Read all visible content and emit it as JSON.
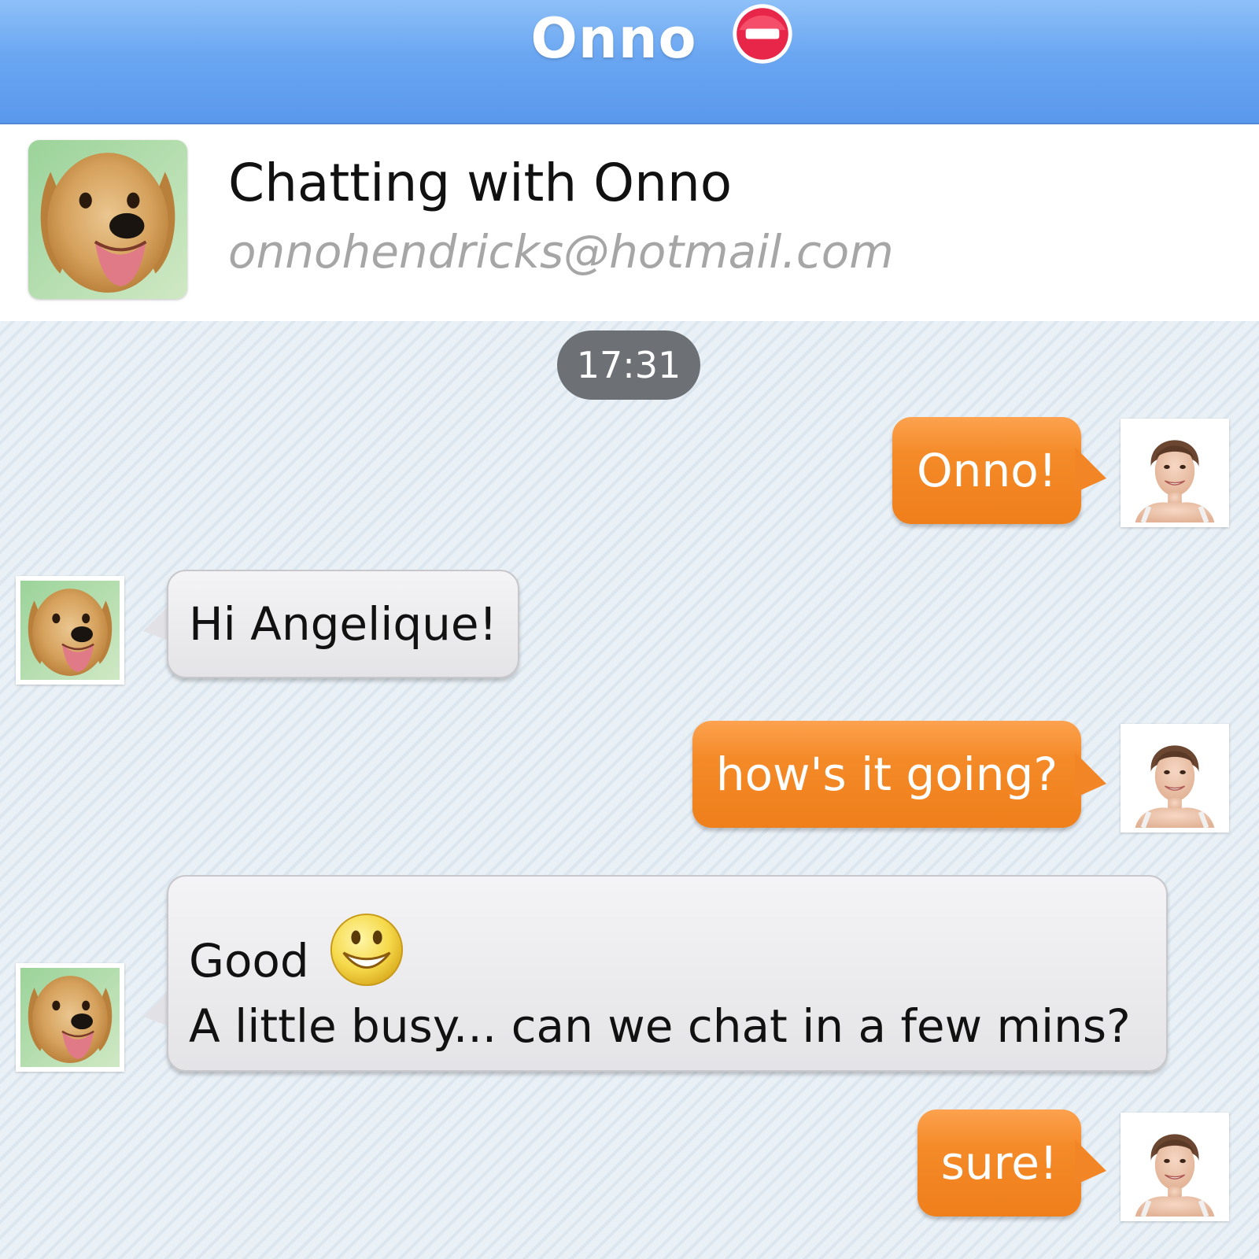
{
  "window": {
    "title": "Onno",
    "status_icon": "busy-icon",
    "accent_color": "#6aa6f1"
  },
  "contact": {
    "chatting_with": "Chatting with Onno",
    "email": "onnohendricks@hotmail.com",
    "avatar_icon": "dog-avatar"
  },
  "chat": {
    "timestamp": "17:31",
    "outgoing_color": "#f48a28",
    "incoming_color": "#e4e4e7",
    "messages": [
      {
        "sender": "me",
        "text": "Onno!"
      },
      {
        "sender": "contact",
        "text": "Hi Angelique!"
      },
      {
        "sender": "me",
        "text": "how's it going?"
      },
      {
        "sender": "contact",
        "line1": "Good",
        "emoticon": "smiley-icon",
        "line2": "A little busy... can we chat in a few mins?"
      },
      {
        "sender": "me",
        "text": "sure!"
      }
    ]
  }
}
